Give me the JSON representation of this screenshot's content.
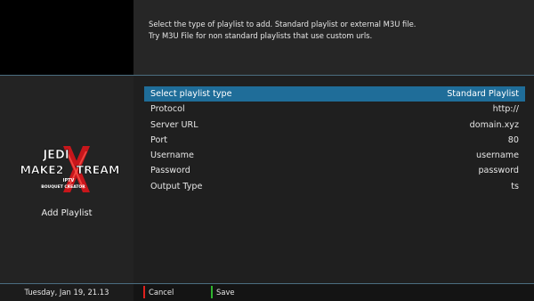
{
  "description": {
    "line1": "Select the type of playlist to add. Standard playlist or external M3U file.",
    "line2": "Try M3U File for non standard playlists that use custom urls."
  },
  "logo": {
    "line1": "JEDI",
    "line2": "MAKE2",
    "line3": "TREAM",
    "line4": "IPTV",
    "line5": "BOUQUET CREATOR"
  },
  "sidebar": {
    "title": "Add Playlist"
  },
  "settings": [
    {
      "label": "Select playlist type",
      "value": "Standard Playlist"
    },
    {
      "label": "Protocol",
      "value": "http://"
    },
    {
      "label": "Server URL",
      "value": "domain.xyz"
    },
    {
      "label": "Port",
      "value": "80"
    },
    {
      "label": "Username",
      "value": "username"
    },
    {
      "label": "Password",
      "value": "password"
    },
    {
      "label": "Output Type",
      "value": "ts"
    }
  ],
  "footer": {
    "datetime": "Tuesday, Jan 19, 21.13",
    "cancel_label": "Cancel",
    "save_label": "Save"
  },
  "colors": {
    "selected": "#1f6d99",
    "cancel": "#e0201e",
    "save": "#2fb52f"
  },
  "icons": {
    "logo_mark": "red-x-emblem"
  }
}
